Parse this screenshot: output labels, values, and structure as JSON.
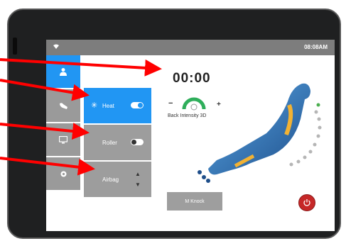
{
  "status": {
    "time": "08:08AM"
  },
  "sidebar": {
    "items": [
      {
        "icon": "user-icon"
      },
      {
        "icon": "massage-icon"
      },
      {
        "icon": "monitor-icon"
      },
      {
        "icon": "settings-icon"
      }
    ]
  },
  "controls": {
    "heat": {
      "label": "Heat",
      "icon": "snowflake-icon",
      "state": "on"
    },
    "roller": {
      "label": "Roller",
      "state": "off"
    },
    "airbag": {
      "label": "Airbag",
      "icon": "up-down-arrows-icon"
    }
  },
  "timer": "00:00",
  "intensity": {
    "label": "Back Intensity 3D",
    "minus": "−",
    "plus": "+"
  },
  "buttons": {
    "knock": "M Knock"
  },
  "colors": {
    "accent": "#2196f3",
    "annotation": "#ff0000",
    "power": "#c62828"
  }
}
